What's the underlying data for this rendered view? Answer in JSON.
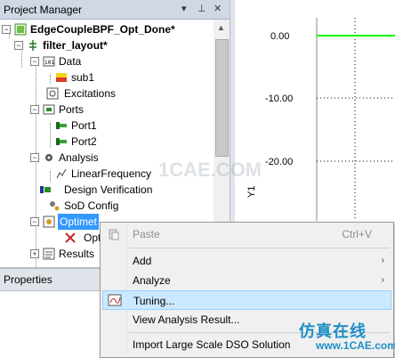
{
  "project_manager": {
    "title": "Project Manager",
    "controls": [
      "▾",
      "⊥",
      "✕"
    ],
    "tree": [
      {
        "label": "EdgeCoupleBPF_Opt_Done*",
        "bold": true
      },
      {
        "label": "filter_layout*",
        "bold": true
      },
      {
        "label": "Data"
      },
      {
        "label": "sub1"
      },
      {
        "label": "Excitations"
      },
      {
        "label": "Ports"
      },
      {
        "label": "Port1"
      },
      {
        "label": "Port2"
      },
      {
        "label": "Analysis"
      },
      {
        "label": "LinearFrequency"
      },
      {
        "label": "Design Verification"
      },
      {
        "label": "SoD Config"
      },
      {
        "label": "Optimet"
      },
      {
        "label": "Opt"
      },
      {
        "label": "Results"
      }
    ]
  },
  "properties": {
    "title": "Properties"
  },
  "chart_data": {
    "type": "line",
    "ylabel": "Y1",
    "yticks": [
      "0.00",
      "-10.00",
      "-20.00"
    ],
    "series": [
      {
        "color": "#00ff00",
        "y": 0.0
      }
    ]
  },
  "context_menu": {
    "items": [
      {
        "label": "Paste",
        "shortcut": "Ctrl+V",
        "disabled": true
      },
      {
        "label": "Add",
        "submenu": true
      },
      {
        "label": "Analyze",
        "submenu": true
      },
      {
        "label": "Tuning...",
        "highlighted": true
      },
      {
        "label": "View Analysis Result..."
      },
      {
        "label": "Import Large Scale DSO Solution"
      }
    ],
    "submenu_arrow": "›"
  },
  "watermark": {
    "text": "仿真在线",
    "site": "www.1CAE.com",
    "faint": "1CAE.COM"
  }
}
